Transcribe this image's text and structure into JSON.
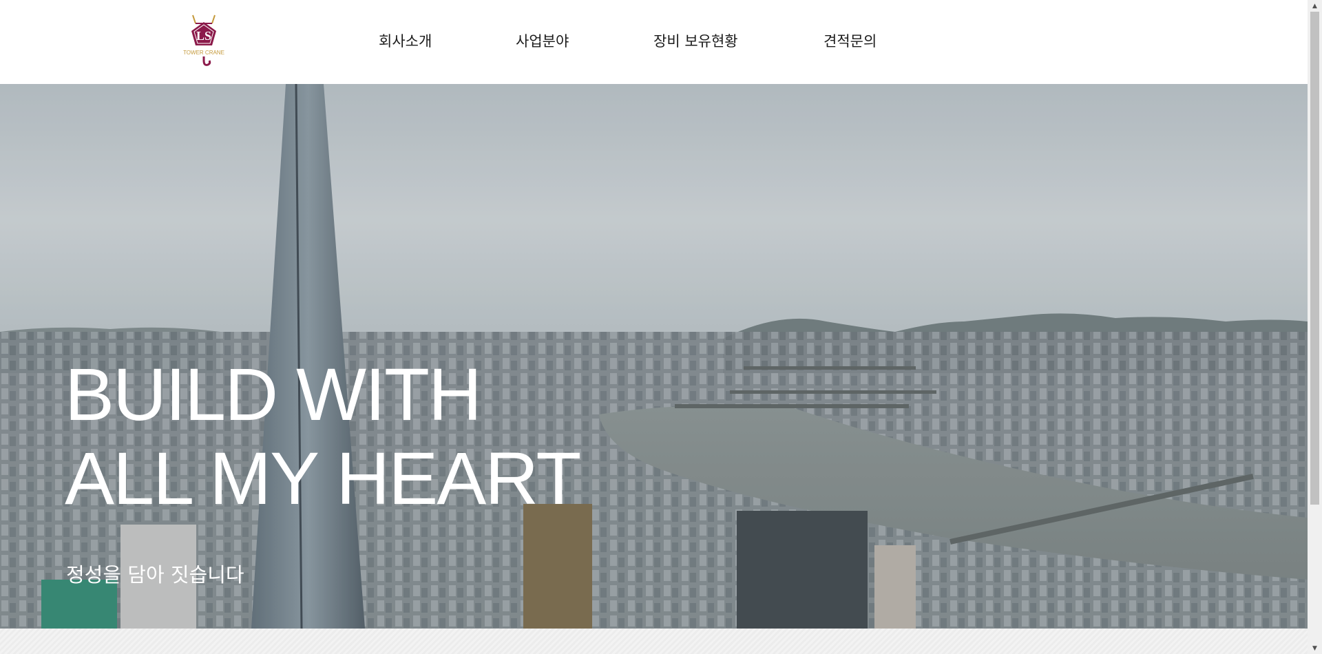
{
  "header": {
    "logo": {
      "letters": "LS",
      "caption": "TOWER CRANE",
      "color": "#8b1a4a",
      "accent": "#c59a3c"
    },
    "nav": [
      {
        "label": "회사소개"
      },
      {
        "label": "사업분야"
      },
      {
        "label": "장비 보유현황"
      },
      {
        "label": "견적문의"
      }
    ]
  },
  "hero": {
    "title_line1": "BUILD WITH",
    "title_line2": "ALL MY HEART",
    "subtitle": "정성을 담아 짓습니다"
  },
  "scrollbar": {
    "up_icon": "triangle-up-icon",
    "down_icon": "triangle-down-icon"
  }
}
